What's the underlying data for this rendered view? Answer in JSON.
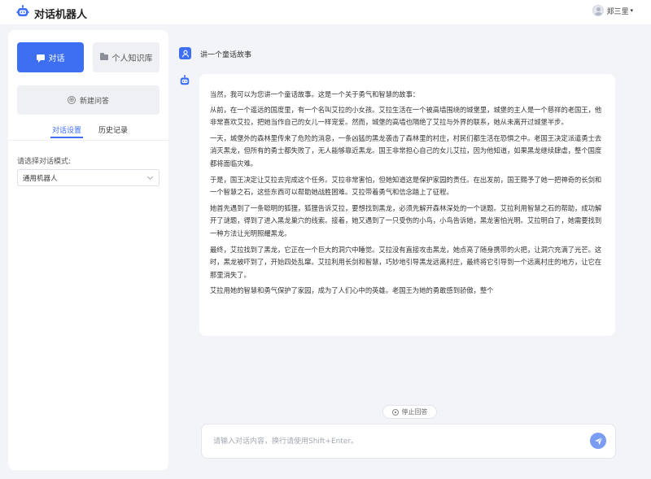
{
  "app": {
    "title": "对话机器人",
    "user_name": "郑三里",
    "user_caret": "▾"
  },
  "sidebar": {
    "chat_button": "对话",
    "knowledge_button": "个人知识库",
    "new_chat_button": "新建问答",
    "new_chat_icon": "⊕",
    "tabs": [
      {
        "label": "对话设置",
        "active": true
      },
      {
        "label": "历史记录",
        "active": false
      }
    ],
    "mode_label": "请选择对话模式:",
    "mode_value": "通用机器人"
  },
  "conversation": {
    "user_message": "讲一个童话故事",
    "bot_paragraphs": [
      "当然，我可以为您讲一个童话故事。这是一个关于勇气和智慧的故事：",
      "从前，在一个遥远的国度里，有一个名叫艾拉的小女孩。艾拉生活在一个被高墙围绕的城堡里，城堡的主人是一个慈祥的老国王，他非常喜欢艾拉，把她当作自己的女儿一样宠爱。然而，城堡的高墙也隔绝了艾拉与外界的联系，她从未离开过城堡半步。",
      "一天，城堡外的森林里传来了危险的消息，一条凶猛的黑龙袭击了森林里的村庄，村民们都生活在恐惧之中。老国王决定派遣勇士去消灭黑龙，但所有的勇士都失败了，无人能够靠近黑龙。国王非常担心自己的女儿艾拉，因为他知道，如果黑龙继续肆虐，整个国度都将面临灾难。",
      "于是，国王决定让艾拉去完成这个任务。艾拉非常害怕，但她知道这是保护家园的责任。在出发前，国王赐予了她一把神奇的长剑和一个智慧之石，这些东西可以帮助她战胜困难。艾拉带着勇气和信念踏上了征程。",
      "她首先遇到了一条聪明的狐狸，狐狸告诉艾拉，要想找到黑龙，必须先解开森林深处的一个谜题。艾拉利用智慧之石的帮助，成功解开了谜题，得到了进入黑龙巢穴的线索。接着，她又遇到了一只受伤的小鸟，小鸟告诉她，黑龙害怕光明。艾拉明白了，她需要找到一种方法让光明照耀黑龙。",
      "最终，艾拉找到了黑龙，它正在一个巨大的洞穴中睡觉。艾拉没有直接攻击黑龙，她点亮了随身携带的火把，让洞穴充满了光芒。这时，黑龙被吓到了，开始四处乱窜。艾拉利用长剑和智慧，巧妙地引导黑龙远离村庄，最终将它引导到一个远离村庄的地方，让它在那里消失了。",
      "艾拉用她的智慧和勇气保护了家园，成为了人们心中的英雄。老国王为她的勇敢感到骄傲，整个"
    ],
    "stop_button": "停止回答",
    "input_placeholder": "请输入对话内容，换行请使用Shift+Enter。",
    "input_value": ""
  },
  "colors": {
    "accent": "#3e6ff2",
    "send_button": "#7b9cf3",
    "background": "#f2f4f7"
  }
}
